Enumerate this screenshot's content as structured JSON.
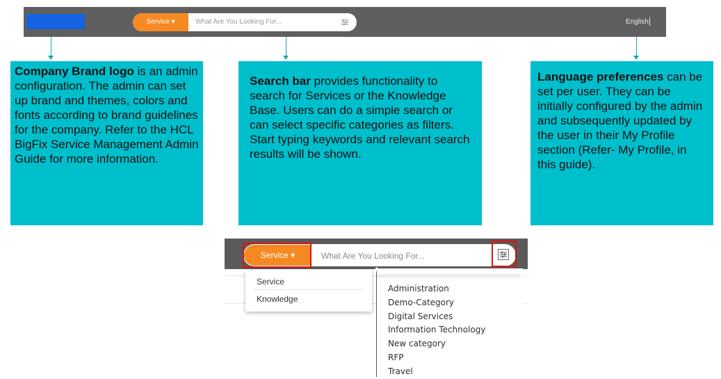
{
  "header": {
    "service_label": "Service",
    "search_placeholder": "What Are You Looking For...",
    "language": "English",
    "logo_color": "#1463e0",
    "bar_color": "#5f5f5f",
    "accent": "#f58a22"
  },
  "callouts": {
    "brand": {
      "title": "Company Brand logo",
      "text": " is an admin configuration. The admin can set up brand and themes, colors and fonts according to brand guidelines for the company. Refer to the HCL BigFix Service Management Admin Guide for more information."
    },
    "search": {
      "title": "Search bar",
      "text": " provides functionality to search for Services or the Knowledge Base. Users can do a simple search or can select specific categories as filters.",
      "text2": "Start typing keywords and relevant search results will be shown."
    },
    "language": {
      "title": "Language preferences",
      "text": " can be set per user. They can be initially configured by the admin and subsequently updated by the user in their My Profile section (Refer- My Profile, in this guide)."
    },
    "color": "#00bfcd"
  },
  "zoom": {
    "service_label": "Service",
    "search_placeholder": "What Are You Looking For...",
    "scope_options": [
      "Service",
      "Knowledge"
    ],
    "categories": [
      "Administration",
      "Demo-Category",
      "Digital Services",
      "Information Technology",
      "New category",
      "RFP",
      "Travel"
    ]
  },
  "icons": [
    "caret-down-icon",
    "filter-sliders-icon"
  ]
}
